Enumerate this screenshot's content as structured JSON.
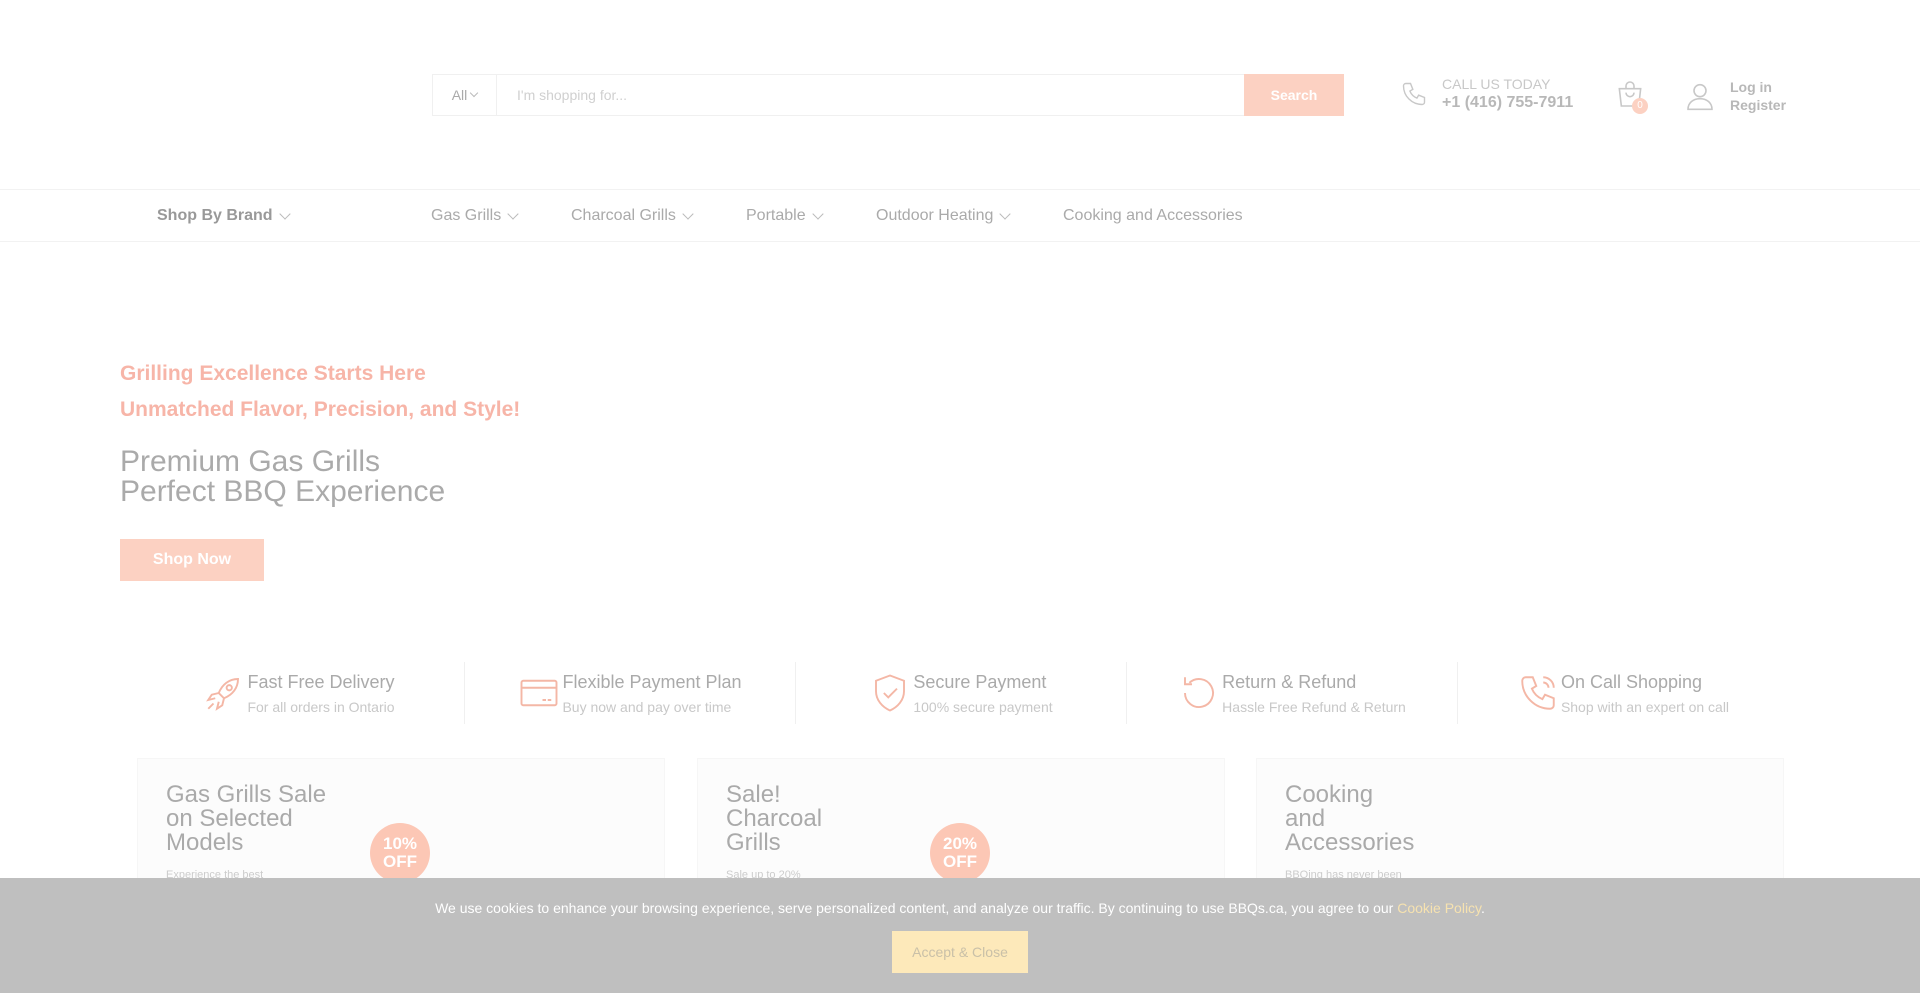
{
  "header": {
    "search": {
      "category": "All",
      "placeholder": "I'm shopping for...",
      "button_label": "Search"
    },
    "call": {
      "label": "CALL US TODAY",
      "phone": "+1 (416) 755-7911"
    },
    "cart": {
      "count": "0"
    },
    "account": {
      "login": "Log in",
      "register": "Register"
    }
  },
  "nav": {
    "brand": "Shop By Brand",
    "items": [
      {
        "label": "Gas Grills"
      },
      {
        "label": "Charcoal Grills"
      },
      {
        "label": "Portable"
      },
      {
        "label": "Outdoor Heating"
      },
      {
        "label": "Cooking and Accessories"
      }
    ]
  },
  "hero": {
    "tagline_1": "Grilling Excellence Starts Here",
    "tagline_2": "Unmatched Flavor, Precision, and Style!",
    "title_1": "Premium Gas Grills",
    "title_2": "Perfect BBQ Experience",
    "cta": "Shop Now"
  },
  "features": [
    {
      "title": "Fast Free Delivery",
      "desc": "For all orders in Ontario",
      "icon": "rocket-icon"
    },
    {
      "title": "Flexible Payment Plan",
      "desc": "Buy now and pay over time",
      "icon": "credit-card-icon"
    },
    {
      "title": "Secure Payment",
      "desc": "100% secure payment",
      "icon": "shield-icon"
    },
    {
      "title": "Return & Refund",
      "desc": "Hassle Free Refund & Return",
      "icon": "refresh-icon"
    },
    {
      "title": "On Call Shopping",
      "desc": "Shop with an expert on call",
      "icon": "phone-call-icon"
    }
  ],
  "promos": [
    {
      "title_1": "Gas Grills Sale",
      "title_2": "on Selected",
      "title_3": "Models",
      "sub": "Experience the best",
      "badge_1": "10%",
      "badge_2": "OFF"
    },
    {
      "title_1": "Sale!",
      "title_2": "Charcoal",
      "title_3": "Grills",
      "sub": "Sale up to 20%",
      "badge_1": "20%",
      "badge_2": "OFF"
    },
    {
      "title_1": "Cooking",
      "title_2": "and",
      "title_3": "Accessories",
      "sub": "BBQing has never been"
    }
  ],
  "cookie": {
    "text": "We use cookies to enhance your browsing experience, serve personalized content, and analyze our traffic. By continuing to use BBQs.ca, you agree to our ",
    "link": "Cookie Policy",
    "suffix": ".",
    "button": "Accept & Close"
  },
  "colors": {
    "accent": "#fcd1c2",
    "tagline": "#f7b5a8",
    "cookie_bar": "#bfbfbf",
    "cookie_button": "#fde9ba"
  }
}
